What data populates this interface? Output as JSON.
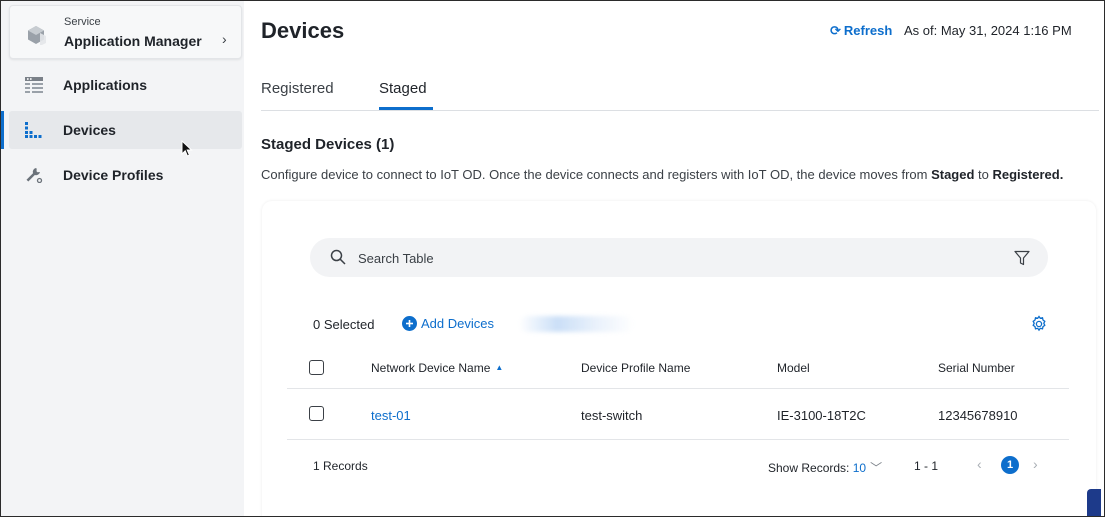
{
  "sidebar": {
    "service_caption": "Service",
    "service_name": "Application Manager",
    "service_chevron": "›",
    "items": [
      {
        "label": "Applications",
        "icon": "applications-icon",
        "active": false
      },
      {
        "label": "Devices",
        "icon": "devices-icon",
        "active": true
      },
      {
        "label": "Device Profiles",
        "icon": "wrench-icon",
        "active": false
      }
    ]
  },
  "header": {
    "title": "Devices",
    "refresh_label": "Refresh",
    "as_of": "As of: May 31, 2024 1:16 PM"
  },
  "tabs": [
    {
      "label": "Registered",
      "active": false
    },
    {
      "label": "Staged",
      "active": true
    }
  ],
  "section": {
    "title": "Staged Devices (1)",
    "description_part1": "Configure device to connect to IoT OD. Once the device connects and registers with IoT OD, the device moves from ",
    "description_bold1": "Staged",
    "description_part2": " to ",
    "description_bold2": "Registered."
  },
  "table": {
    "search_placeholder": "Search Table",
    "selected_text": "0 Selected",
    "add_devices_label": "Add Devices",
    "columns": [
      "Network Device Name",
      "Device Profile Name",
      "Model",
      "Serial Number"
    ],
    "sort_indicator": "▲",
    "rows": [
      {
        "network_device_name": "test-01",
        "device_profile_name": "test-switch",
        "model": "IE-3100-18T2C",
        "serial_number": "12345678910"
      }
    ]
  },
  "pagination": {
    "records_text": "1 Records",
    "show_records_label": "Show Records:",
    "show_records_value": "10",
    "range": "1 - 1",
    "current_page": "1",
    "prev": "‹",
    "next": "›"
  },
  "colors": {
    "accent": "#0d6ecc",
    "sidebar_bg": "#f3f4f6",
    "text": "#1f2329"
  }
}
